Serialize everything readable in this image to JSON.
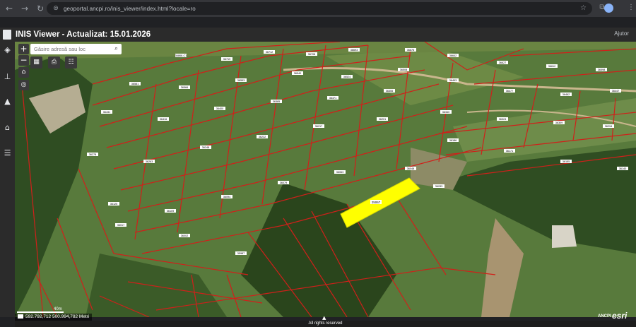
{
  "browser": {
    "url": "geoportal.ancpi.ro/inis_viewer/index.html?locale=ro"
  },
  "header": {
    "title": "INIS Viewer - Actualizat: 15.01.2026",
    "help_label": "Ajutor"
  },
  "search": {
    "placeholder": "Găsire adresă sau loc"
  },
  "map": {
    "scale_label": "40m",
    "coordinates": "592.792,712 500.994,782 Metri",
    "attribution": "All rights reserved",
    "brand_ancpi": "ANCPI",
    "brand_esri": "esri",
    "highlighted_parcel_label": "25067",
    "parcel_labels": [
      "36868-C1",
      "36719",
      "36712",
      "36708",
      "36693",
      "36676",
      "36642",
      "36627",
      "36612",
      "36598",
      "36581",
      "36566",
      "36553",
      "36540",
      "36524",
      "36508",
      "36493",
      "36477",
      "36462",
      "36447",
      "36431",
      "36416",
      "36400",
      "36385",
      "36371",
      "36355",
      "36340",
      "36324",
      "36309",
      "36294",
      "36278",
      "36263",
      "36248",
      "36232",
      "36217",
      "36201",
      "36186",
      "36171",
      "36155",
      "36140",
      "36125",
      "36109",
      "36094",
      "36079",
      "36063",
      "36048",
      "36033",
      "36017",
      "36002",
      "35987"
    ]
  },
  "colors": {
    "parcel_line": "#d0201a",
    "highlight": "#ffff00",
    "header_bg": "#2b2b2b"
  }
}
